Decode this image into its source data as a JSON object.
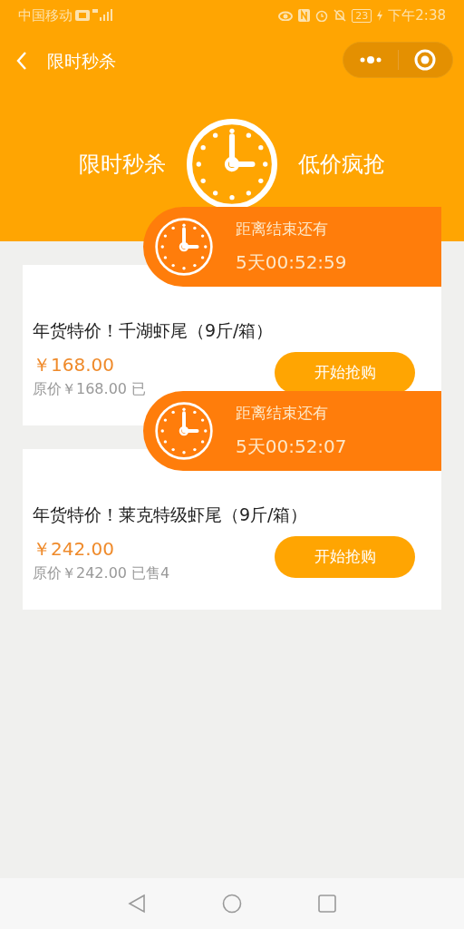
{
  "status_bar": {
    "carrier": "中国移动",
    "battery": "23",
    "time": "下午2:38"
  },
  "nav": {
    "title": "限时秒杀"
  },
  "hero": {
    "left": "限时秒杀",
    "right": "低价疯抢"
  },
  "items": [
    {
      "countdown_label": "距离结束还有",
      "countdown": "5天00:52:59",
      "title": "年货特价！千湖虾尾（9斤/箱）",
      "price": "￥168.00",
      "original": "原价￥168.00 已",
      "button": "开始抢购"
    },
    {
      "countdown_label": "距离结束还有",
      "countdown": "5天00:52:07",
      "title": "年货特价！莱克特级虾尾（9斤/箱）",
      "price": "￥242.00",
      "original": "原价￥242.00 已售4",
      "button": "开始抢购"
    }
  ]
}
